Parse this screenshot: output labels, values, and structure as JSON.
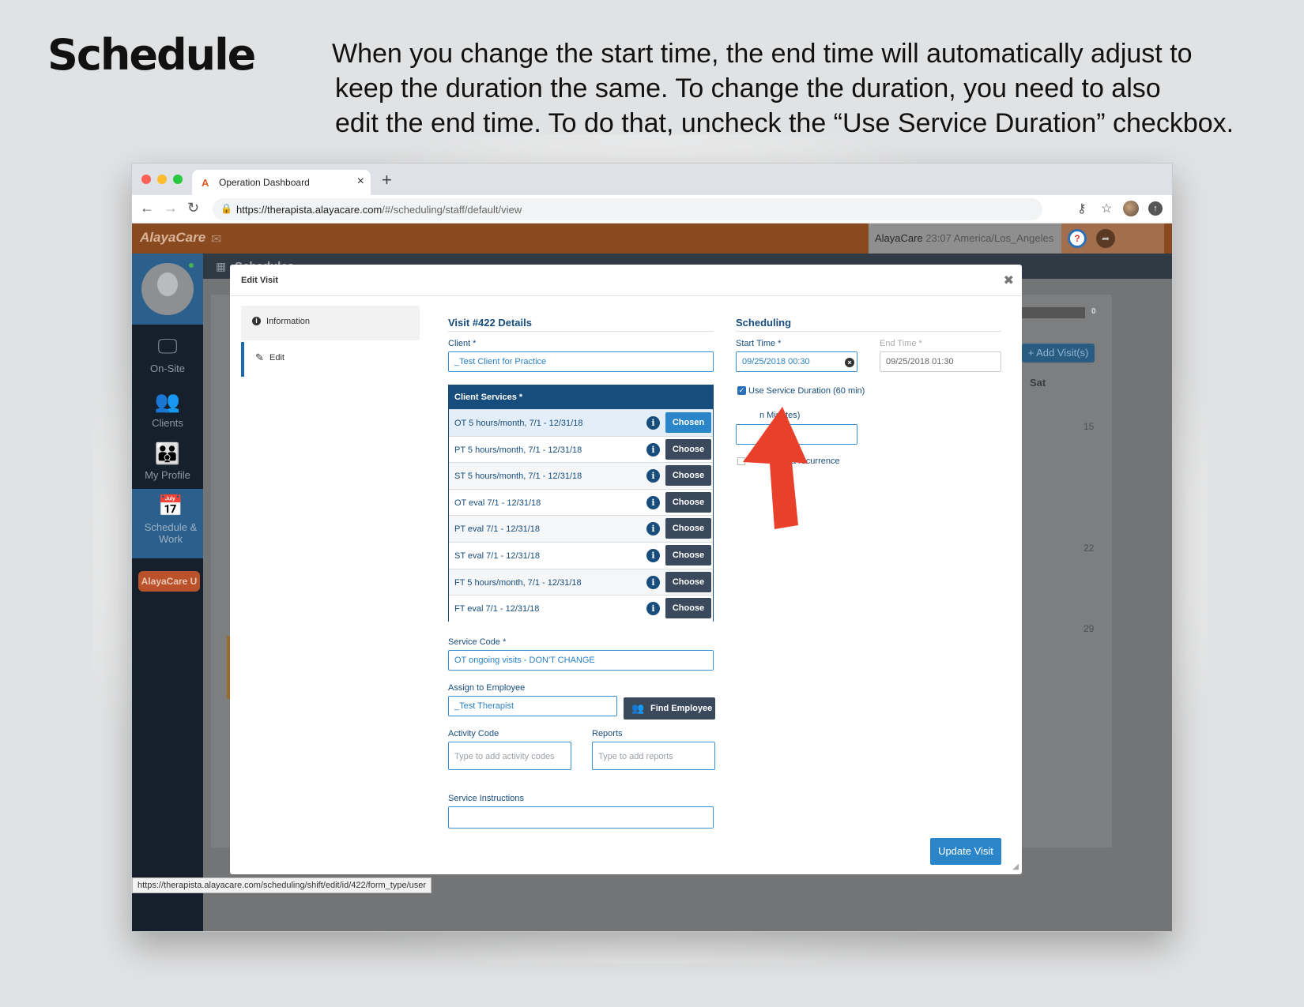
{
  "page": {
    "title": "Schedule",
    "description_lines": [
      "When you change the start time, the end time will automatically adjust to",
      "keep the duration the same. To change the duration, you need to also",
      "edit the end time. To do that, uncheck the “Use Service Duration” checkbox."
    ]
  },
  "browser": {
    "tab_title": "Operation Dashboard",
    "url_host": "https://therapista.alayacare.com",
    "url_path": "/#/scheduling/staff/default/view",
    "status_url": "https://therapista.alayacare.com/scheduling/shift/edit/id/422/form_type/user"
  },
  "app": {
    "brand": "AlayaCare",
    "header_user": "AlayaCare",
    "header_time": "23:07 America/Los_Angeles",
    "help_label": "?",
    "section_title": "Schedules",
    "sidebar": [
      {
        "label": "On-Site"
      },
      {
        "label": "Clients"
      },
      {
        "label": "My Profile"
      },
      {
        "label": "Schedule & Work"
      }
    ],
    "alayacare_u": "AlayaCare U",
    "background": {
      "progress_value": "0",
      "add_visits": "+ Add Visit(s)",
      "day_header": "Sat",
      "days": [
        "15",
        "22",
        "29"
      ]
    }
  },
  "modal": {
    "title": "Edit Visit",
    "nav": {
      "information": "Information",
      "edit": "Edit"
    },
    "details_title": "Visit #422 Details",
    "client_label": "Client *",
    "client_value": "_Test Client for Practice",
    "services_header": "Client Services *",
    "services": [
      {
        "label": "OT 5 hours/month, 7/1 - 12/31/18",
        "button": "Chosen",
        "chosen": true
      },
      {
        "label": "PT 5 hours/month, 7/1 - 12/31/18",
        "button": "Choose",
        "chosen": false
      },
      {
        "label": "ST 5 hours/month, 7/1 - 12/31/18",
        "button": "Choose",
        "chosen": false
      },
      {
        "label": "OT eval 7/1 - 12/31/18",
        "button": "Choose",
        "chosen": false
      },
      {
        "label": "PT eval 7/1 - 12/31/18",
        "button": "Choose",
        "chosen": false
      },
      {
        "label": "ST eval 7/1 - 12/31/18",
        "button": "Choose",
        "chosen": false
      },
      {
        "label": "FT 5 hours/month, 7/1 - 12/31/18",
        "button": "Choose",
        "chosen": false
      },
      {
        "label": "FT eval 7/1 - 12/31/18",
        "button": "Choose",
        "chosen": false
      }
    ],
    "service_code_label": "Service Code *",
    "service_code_value": "OT ongoing visits - DON'T CHANGE",
    "assign_label": "Assign to Employee",
    "assign_value": "_Test Therapist",
    "find_employee": "Find Employee",
    "activity_label": "Activity Code",
    "activity_placeholder": "Type to add activity codes",
    "reports_label": "Reports",
    "reports_placeholder": "Type to add reports",
    "instructions_label": "Service Instructions",
    "scheduling_title": "Scheduling",
    "start_label": "Start Time *",
    "start_value": "09/25/2018 00:30",
    "end_label": "End Time *",
    "end_value": "09/25/2018 01:30",
    "use_duration_label": "Use Service Duration (60 min)",
    "duration_label_partial": "n Minutes)",
    "recurrence_label_partial": "e as a recurrence",
    "update_button": "Update Visit"
  },
  "colors": {
    "accent": "#2a86c8",
    "header_brown": "#8a4a1f",
    "navy": "#174d7c",
    "arrow_red": "#e8402a"
  }
}
